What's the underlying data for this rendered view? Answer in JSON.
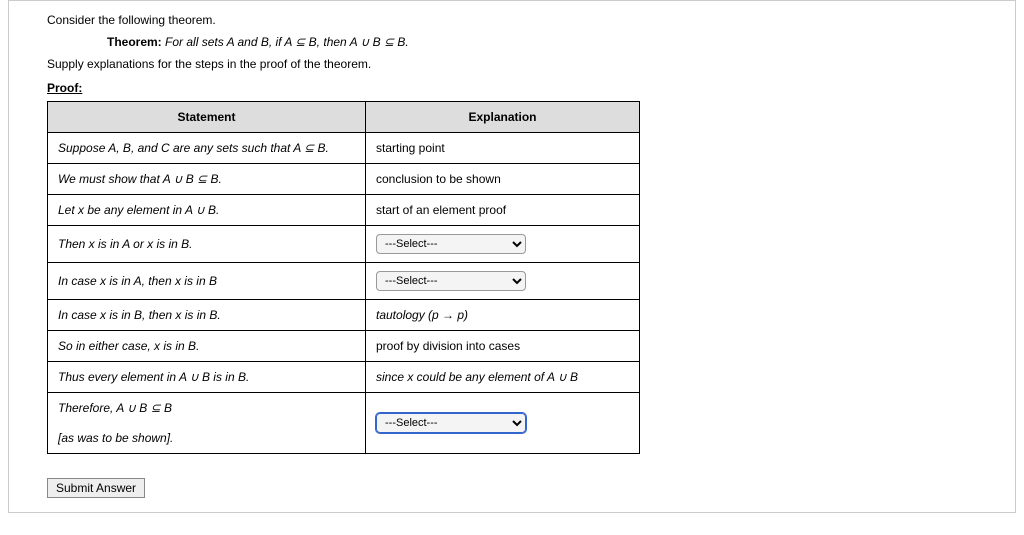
{
  "intro": {
    "consider": "Consider the following theorem.",
    "theorem_label": "Theorem:",
    "theorem_text": " For all sets A and B, if A ⊆ B, then A ∪ B ⊆ B.",
    "supply": "Supply explanations for the steps in the proof of the theorem.",
    "proof_label": "Proof:"
  },
  "headers": {
    "statement": "Statement",
    "explanation": "Explanation"
  },
  "rows": [
    {
      "stmt": "Suppose A, B, and C are any sets such that A ⊆ B.",
      "expl_type": "text",
      "expl": "starting point"
    },
    {
      "stmt": "We must show that A ∪ B ⊆ B.",
      "expl_type": "text",
      "expl": "conclusion to be shown"
    },
    {
      "stmt": "Let x be any element in A ∪ B.",
      "expl_type": "text",
      "expl": "start of an element proof"
    },
    {
      "stmt": "Then x is in A or x is in B.",
      "expl_type": "select",
      "selected": "---Select---"
    },
    {
      "stmt": "In case x is in A, then x is in B",
      "expl_type": "select",
      "selected": "---Select---"
    },
    {
      "stmt": "In case x is in B, then x is in B.",
      "expl_type": "text",
      "expl": "tautology (p → p)"
    },
    {
      "stmt": "So in either case, x is in B.",
      "expl_type": "text",
      "expl": "proof by division into cases"
    },
    {
      "stmt": "Thus every element in A ∪ B is in B.",
      "expl_type": "text",
      "expl": "since x could be any element of A ∪ B"
    },
    {
      "stmt": "Therefore, A ∪ B ⊆ B",
      "expl_type": "select_active",
      "selected": "---Select---"
    },
    {
      "stmt": "[as was to be shown].",
      "expl_type": "empty",
      "expl": ""
    }
  ],
  "buttons": {
    "submit": "Submit Answer"
  },
  "select_placeholder": "---Select---"
}
